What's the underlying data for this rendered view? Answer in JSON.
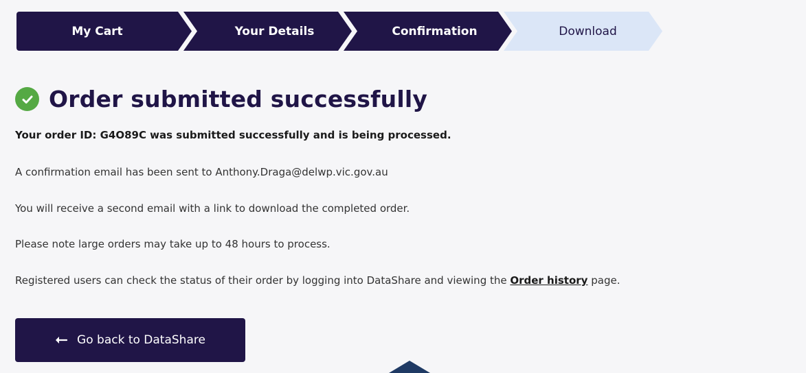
{
  "stepper": {
    "steps": [
      {
        "label": "My Cart",
        "state": "complete"
      },
      {
        "label": "Your Details",
        "state": "complete"
      },
      {
        "label": "Confirmation",
        "state": "complete"
      },
      {
        "label": "Download",
        "state": "current"
      }
    ]
  },
  "heading": {
    "icon": "check-circle-icon",
    "title": "Order submitted successfully"
  },
  "messages": {
    "order_id_line": "Your order ID: G4O89C was submitted successfully and is being processed.",
    "confirmation_email": "A confirmation email has been sent to Anthony.Draga@delwp.vic.gov.au",
    "second_email": "You will receive a second email with a link to download the completed order.",
    "large_orders": "Please note large orders may take up to 48 hours to process.",
    "registered_prefix": "Registered users can check the status of their order by logging into DataShare and viewing the ",
    "order_history_link": "Order history",
    "registered_suffix": " page."
  },
  "actions": {
    "back_icon": "arrow-left-icon",
    "back_label": "Go back to DataShare"
  },
  "colors": {
    "primary_navy": "#201547",
    "success_green": "#55a944",
    "current_step_bg": "#dbe6f7",
    "page_bg": "#f6f6f8"
  }
}
